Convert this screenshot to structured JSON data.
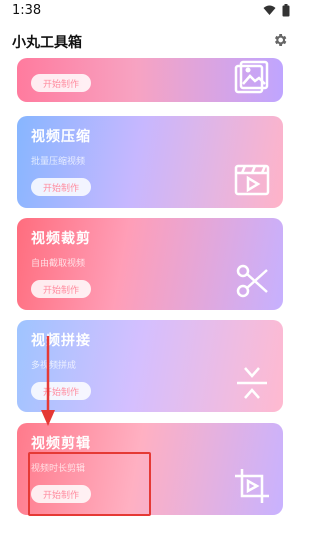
{
  "status_bar": {
    "time": "1:38"
  },
  "header": {
    "title": "小丸工具箱"
  },
  "cards": [
    {
      "title": "",
      "desc": "",
      "button": "开始制作",
      "icon": "image-gallery-icon"
    },
    {
      "title": "视频压缩",
      "desc": "批量压缩视频",
      "button": "开始制作",
      "icon": "video-compress-icon"
    },
    {
      "title": "视频裁剪",
      "desc": "自由截取视频",
      "button": "开始制作",
      "icon": "scissors-icon"
    },
    {
      "title": "视频拼接",
      "desc": "多视频拼成",
      "button": "开始制作",
      "icon": "merge-icon"
    },
    {
      "title": "视频剪辑",
      "desc": "视频时长剪辑",
      "button": "开始制作",
      "icon": "crop-play-icon"
    }
  ],
  "colors": {
    "annotation": "#e53935",
    "button_text": "#ff8da0"
  }
}
